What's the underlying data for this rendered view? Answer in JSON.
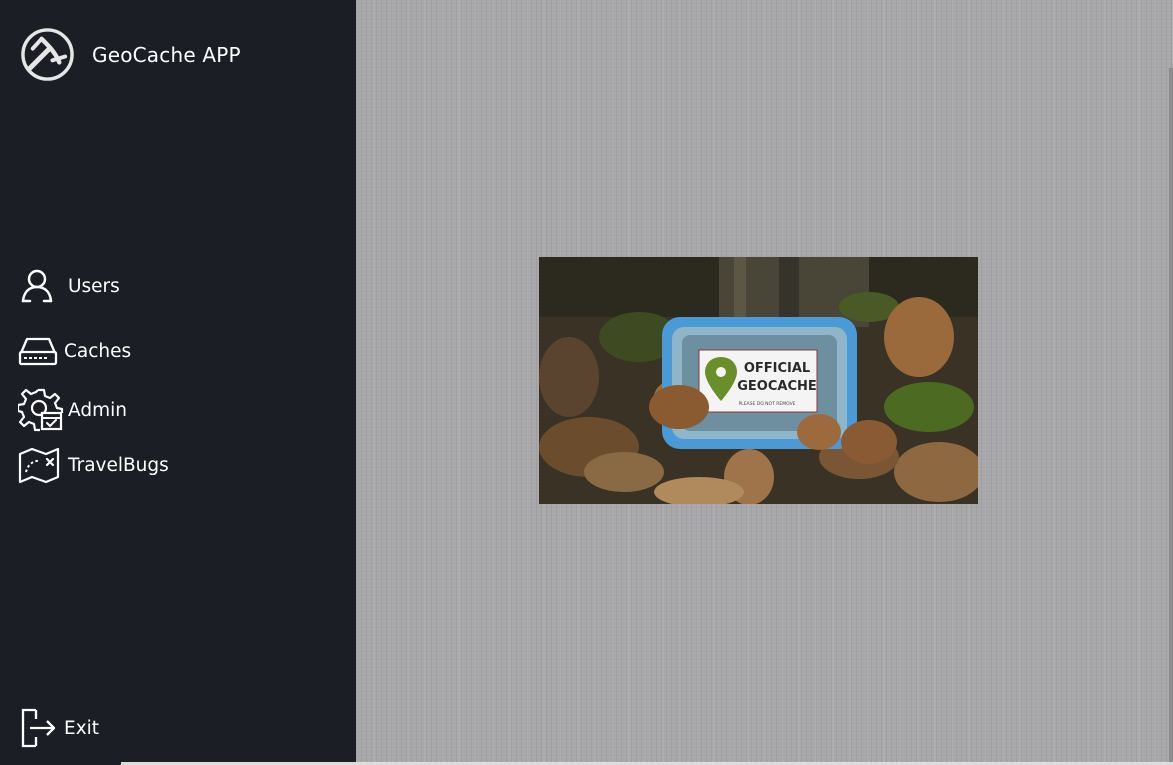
{
  "app": {
    "title": "GeoCache APP",
    "logo_icon": "geocaching-logo-icon"
  },
  "nav": {
    "users_label": "Users",
    "caches_label": "Caches",
    "admin_label": "Admin",
    "travelbugs_label": "TravelBugs",
    "exit_label": "Exit"
  },
  "photo": {
    "sign_line1": "OFFICIAL",
    "sign_line2": "GEOCACHE",
    "sign_line3": "PLEASE DO NOT REMOVE"
  },
  "colors": {
    "sidebar_bg": "#1c1e26",
    "content_bg": "#a7a7a9",
    "accent_green": "#6a8f2a",
    "container_blue": "#4a9ad8"
  }
}
